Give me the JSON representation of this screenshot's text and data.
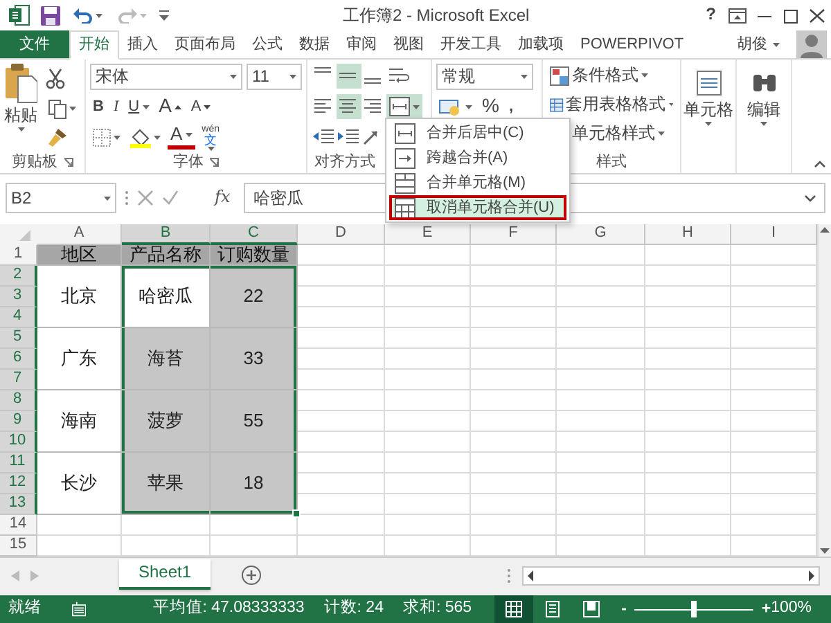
{
  "window": {
    "title": "工作簿2 - Microsoft Excel",
    "help": "?"
  },
  "ribbon_tabs": [
    {
      "label": "文件",
      "kind": "file",
      "selected": false
    },
    {
      "label": "开始",
      "kind": "tab",
      "selected": true
    },
    {
      "label": "插入",
      "kind": "tab",
      "selected": false
    },
    {
      "label": "页面布局",
      "kind": "tab",
      "selected": false
    },
    {
      "label": "公式",
      "kind": "tab",
      "selected": false
    },
    {
      "label": "数据",
      "kind": "tab",
      "selected": false
    },
    {
      "label": "审阅",
      "kind": "tab",
      "selected": false
    },
    {
      "label": "视图",
      "kind": "tab",
      "selected": false
    },
    {
      "label": "开发工具",
      "kind": "tab",
      "selected": false
    },
    {
      "label": "加载项",
      "kind": "tab",
      "selected": false
    },
    {
      "label": "POWERPIVOT",
      "kind": "tab",
      "selected": false
    }
  ],
  "account": {
    "name": "胡俊"
  },
  "clipboard": {
    "paste": "粘贴",
    "label": "剪贴板"
  },
  "font": {
    "name": "宋体",
    "size": "11",
    "bold": "B",
    "italic": "I",
    "underline": "U",
    "grow": "A",
    "shrink": "A",
    "color_letter": "A",
    "phonetic_top": "wén",
    "phonetic": "文",
    "label": "字体"
  },
  "alignment": {
    "vertical": [
      {
        "kind": "top",
        "selected": false
      },
      {
        "kind": "middle",
        "selected": true
      },
      {
        "kind": "bottom",
        "selected": false
      }
    ],
    "horizontal": [
      {
        "kind": "left",
        "selected": false
      },
      {
        "kind": "center",
        "selected": true
      },
      {
        "kind": "right",
        "selected": false
      }
    ],
    "merge_expanded": true,
    "label": "对齐方式"
  },
  "number": {
    "format": "常规",
    "percent": "%",
    "comma": ","
  },
  "styles": {
    "items": [
      {
        "label": "条件格式",
        "kind": "conditional"
      },
      {
        "label": "套用表格格式",
        "kind": "table"
      },
      {
        "label": "单元格样式",
        "kind": "cell-style"
      }
    ],
    "label": "样式"
  },
  "cells_button": {
    "label": "单元格"
  },
  "editing_button": {
    "label": "编辑"
  },
  "merge_menu": [
    {
      "label": "合并后居中(C)",
      "kind": "merge-center",
      "selected": false
    },
    {
      "label": "跨越合并(A)",
      "kind": "merge-across",
      "selected": false
    },
    {
      "label": "合并单元格(M)",
      "kind": "merge-cells",
      "selected": false
    },
    {
      "label": "取消单元格合并(U)",
      "kind": "unmerge",
      "selected": true
    }
  ],
  "formula_bar": {
    "name_box": "B2",
    "insert_function": "fx",
    "value": "哈密瓜"
  },
  "sheet": {
    "columns": [
      {
        "label": "A",
        "selected": false
      },
      {
        "label": "B",
        "selected": true
      },
      {
        "label": "C",
        "selected": true
      },
      {
        "label": "D",
        "selected": false
      },
      {
        "label": "E",
        "selected": false
      },
      {
        "label": "F",
        "selected": false
      },
      {
        "label": "G",
        "selected": false
      },
      {
        "label": "H",
        "selected": false
      },
      {
        "label": "I",
        "selected": false
      }
    ],
    "row_numbers": [
      {
        "label": "1",
        "selected": false
      },
      {
        "label": "2",
        "selected": true
      },
      {
        "label": "3",
        "selected": true
      },
      {
        "label": "4",
        "selected": true
      },
      {
        "label": "5",
        "selected": true
      },
      {
        "label": "6",
        "selected": true
      },
      {
        "label": "7",
        "selected": true
      },
      {
        "label": "8",
        "selected": true
      },
      {
        "label": "9",
        "selected": true
      },
      {
        "label": "10",
        "selected": true
      },
      {
        "label": "11",
        "selected": true
      },
      {
        "label": "12",
        "selected": true
      },
      {
        "label": "13",
        "selected": true
      },
      {
        "label": "14",
        "selected": false
      },
      {
        "label": "15",
        "selected": false
      }
    ],
    "header": [
      "地区",
      "产品名称",
      "订购数量"
    ],
    "groups": [
      {
        "cells": [
          {
            "text": "北京",
            "selected": false,
            "active": false
          },
          {
            "text": "哈密瓜",
            "selected": true,
            "active": true
          },
          {
            "text": "22",
            "selected": true,
            "active": false
          }
        ]
      },
      {
        "cells": [
          {
            "text": "广东",
            "selected": false,
            "active": false
          },
          {
            "text": "海苔",
            "selected": true,
            "active": false
          },
          {
            "text": "33",
            "selected": true,
            "active": false
          }
        ]
      },
      {
        "cells": [
          {
            "text": "海南",
            "selected": false,
            "active": false
          },
          {
            "text": "菠萝",
            "selected": true,
            "active": false
          },
          {
            "text": "55",
            "selected": true,
            "active": false
          }
        ]
      },
      {
        "cells": [
          {
            "text": "长沙",
            "selected": false,
            "active": false
          },
          {
            "text": "苹果",
            "selected": true,
            "active": false
          },
          {
            "text": "18",
            "selected": true,
            "active": false
          }
        ]
      }
    ]
  },
  "sheet_tabs": [
    {
      "label": "Sheet1",
      "selected": true
    }
  ],
  "status_bar": {
    "state": "就绪",
    "average": "平均值: 47.08333333",
    "count": "计数: 24",
    "sum": "求和: 565",
    "views": [
      {
        "kind": "normal",
        "selected": true
      },
      {
        "kind": "page-layout",
        "selected": false
      },
      {
        "kind": "page-break",
        "selected": false
      }
    ],
    "zoom_out": "-",
    "zoom": {
      "level": 0.5
    },
    "zoom_in": "+",
    "zoom_label": "100%"
  }
}
